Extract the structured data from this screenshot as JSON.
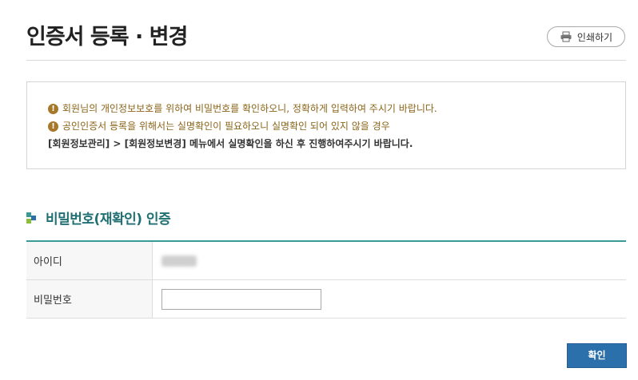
{
  "page": {
    "title": "인증서 등록 · 변경",
    "print_label": "인쇄하기"
  },
  "notice": {
    "line1": "회원님의 개인정보보호를 위하여 비밀번호를 확인하오니, 정확하게 입력하여 주시기 바랍니다.",
    "line2": "공인인증서 등록을 위해서는 실명확인이 필요하오니 실명확인 되어 있지 않을 경우",
    "line3": "[회원정보관리] > [회원정보변경] 메뉴에서 실명확인을 하신 후 진행하여주시기 바랍니다.",
    "warn_icon": "exclamation-circle-icon",
    "warn_color": "#a8782a"
  },
  "section": {
    "title": "비밀번호(재확인) 인증",
    "icon": "square-bullets-icon",
    "title_color": "#1f6f73"
  },
  "form": {
    "id_label": "아이디",
    "password_label": "비밀번호",
    "password_value": "",
    "header_rule_color": "#3a9a96"
  },
  "actions": {
    "confirm_label": "확인",
    "confirm_color": "#2b6fab"
  }
}
